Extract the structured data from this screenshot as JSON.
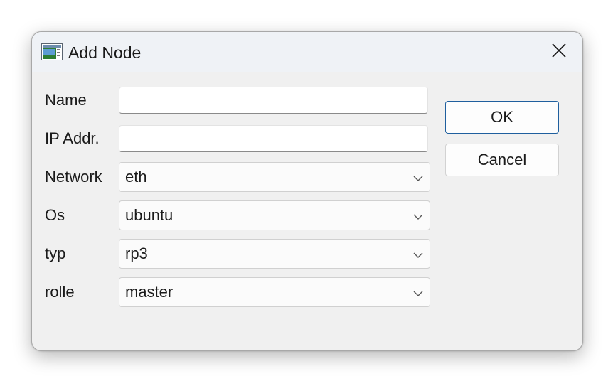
{
  "window": {
    "title": "Add Node",
    "app_icon": "dialog-app-icon",
    "close_icon": "close-icon"
  },
  "form": {
    "name": {
      "label": "Name",
      "value": ""
    },
    "ip_addr": {
      "label": "IP Addr.",
      "value": ""
    },
    "network": {
      "label": "Network",
      "value": "eth"
    },
    "os": {
      "label": "Os",
      "value": "ubuntu"
    },
    "typ": {
      "label": "typ",
      "value": "rp3"
    },
    "rolle": {
      "label": "rolle",
      "value": "master"
    }
  },
  "buttons": {
    "ok_label": "OK",
    "cancel_label": "Cancel"
  },
  "colors": {
    "primary_border": "#1f5f9e",
    "dialog_background": "#f0f0f0",
    "titlebar_background": "#eff2f6"
  }
}
